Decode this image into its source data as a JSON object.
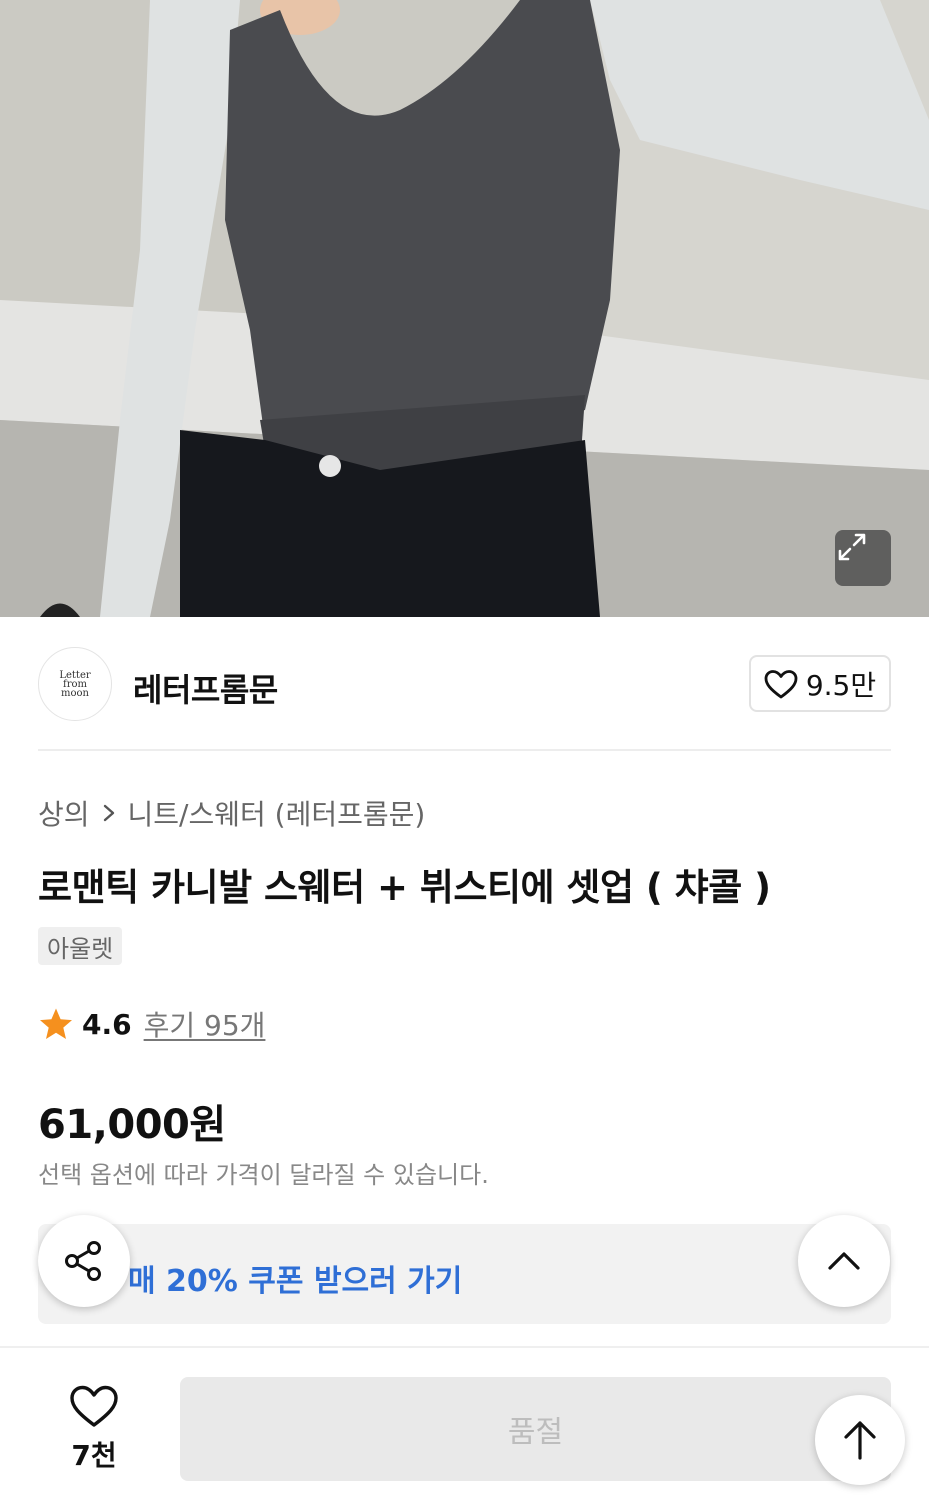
{
  "hero": {
    "image_icon": "product-photo",
    "expand_icon": "expand-icon"
  },
  "brand": {
    "logo_lines": [
      "Letter",
      "from",
      "moon"
    ],
    "name": "레터프롬문",
    "like_icon": "heart-outline-icon",
    "like_count": "9.5만"
  },
  "breadcrumb": {
    "parent": "상의",
    "separator_icon": "chevron-right-icon",
    "current": "니트/스웨터 (레터프롬문)"
  },
  "product": {
    "title": "로맨틱 카니발 스웨터 + 뷔스티에 셋업 ( 챠콜 )",
    "tag": "아울렛",
    "rating_icon": "star-icon",
    "rating": "4.6",
    "reviews": "후기 95개",
    "price": "61,000원",
    "price_note": "선택 옵션에 따라 가격이 달라질 수 있습니다."
  },
  "coupon": {
    "text": "매 20% 쿠폰 받으러 가기"
  },
  "floating": {
    "share_icon": "share-icon",
    "collapse_icon": "chevron-up-icon",
    "top_icon": "arrow-up-icon"
  },
  "bottom_bar": {
    "wish_icon": "heart-outline-icon",
    "wish_count": "7천",
    "buy_label": "품절"
  },
  "colors": {
    "accent": "#2f6fd6",
    "star": "#f5901e",
    "soldout_bg": "#e9e9e9"
  }
}
